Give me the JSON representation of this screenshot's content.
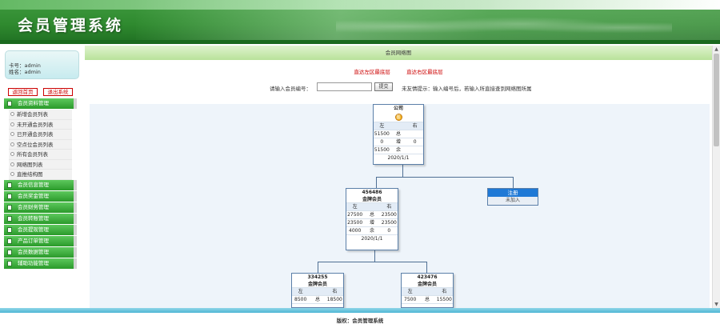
{
  "header": {
    "title": "会员管理系统"
  },
  "user": {
    "card_line": "卡号：admin",
    "name_line": "姓名：admin"
  },
  "buttons": {
    "home": "返回首页",
    "logout": "退出系统"
  },
  "menu": [
    {
      "label": "会员资料管理",
      "items": [
        "新增会员列表",
        "未开通会员列表",
        "已开通会员列表",
        "空点位会员列表",
        "所有会员列表",
        "网络图列表",
        "直推结构图"
      ]
    },
    {
      "label": "会员信息管理",
      "items": []
    },
    {
      "label": "会员奖金管理",
      "items": []
    },
    {
      "label": "会员财务管理",
      "items": []
    },
    {
      "label": "会员转账管理",
      "items": []
    },
    {
      "label": "会员提现管理",
      "items": []
    },
    {
      "label": "产品订单管理",
      "items": []
    },
    {
      "label": "会员数据管理",
      "items": []
    },
    {
      "label": "辅助功能管理",
      "items": []
    }
  ],
  "main": {
    "title": "会员网络图",
    "link_left": "直达左区最底层",
    "link_right": "直达右区最底层",
    "search_label": "请输入会员编号：",
    "search_value": "",
    "search_button": "提交",
    "tip": "未友情提示：输入编号后，若输入所直接查到网络图所属"
  },
  "tree": {
    "root": {
      "title": "公司",
      "badge": "图",
      "left": "左",
      "right": "右",
      "r1": [
        "51500",
        "总",
        ""
      ],
      "r2": [
        "0",
        "增",
        "0"
      ],
      "r3": [
        "51500",
        "余",
        ""
      ],
      "date": "2020/1/1"
    },
    "n1": {
      "id": "456486",
      "level": "金牌会员",
      "left": "左",
      "right": "右",
      "r1": [
        "27500",
        "总",
        "23500"
      ],
      "r2": [
        "23500",
        "增",
        "23500"
      ],
      "r3": [
        "4000",
        "余",
        "0"
      ],
      "date": "2020/1/1"
    },
    "reg": {
      "title": "注册",
      "sub": "未加入"
    },
    "n2": {
      "id": "334255",
      "level": "金牌会员",
      "left": "左",
      "right": "右",
      "r1": [
        "8500",
        "总",
        "18500"
      ]
    },
    "n3": {
      "id": "423476",
      "level": "金牌会员",
      "left": "左",
      "right": "右",
      "r1": [
        "7500",
        "总",
        "15500"
      ]
    }
  },
  "footer": {
    "text": "版权：会员管理系统"
  }
}
